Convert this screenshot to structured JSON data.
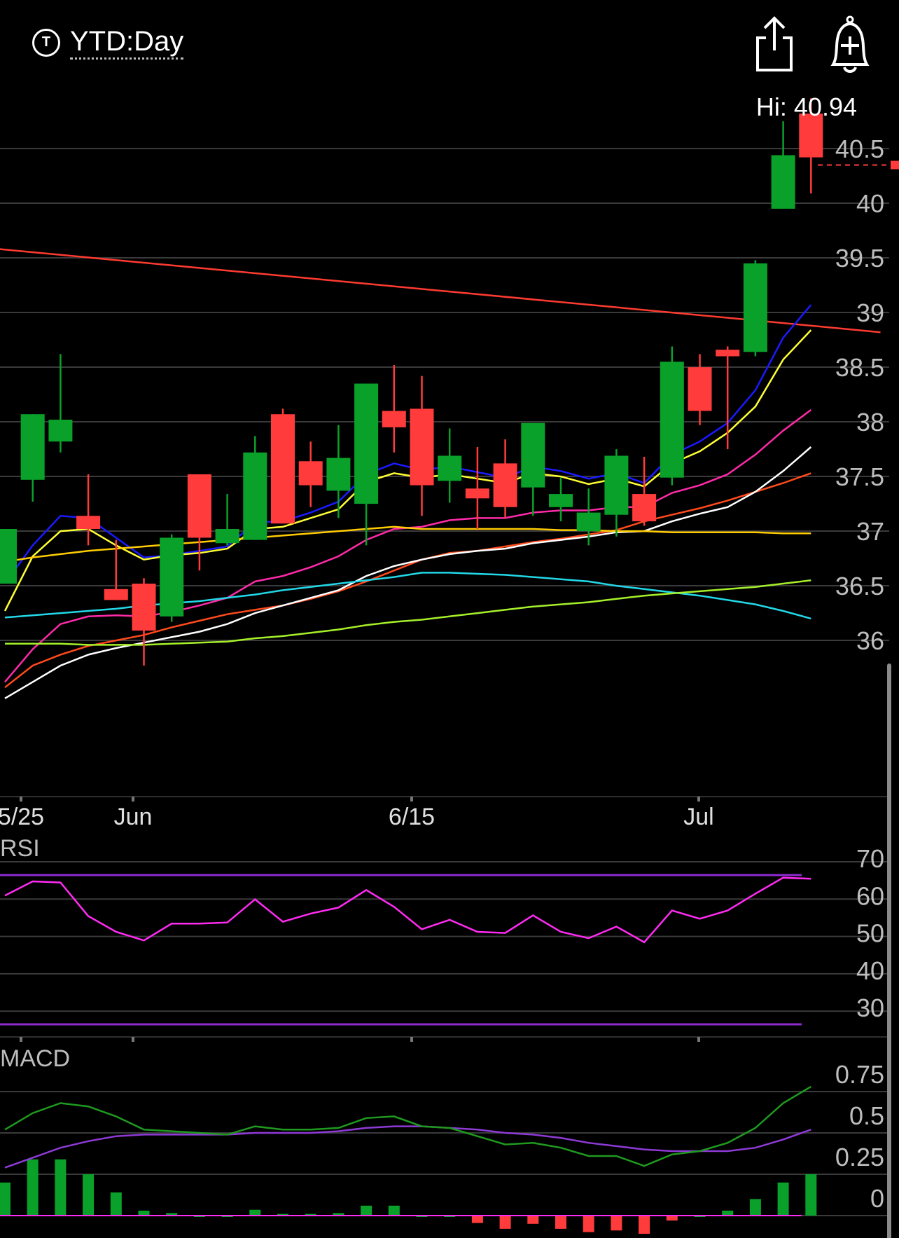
{
  "header": {
    "ticker_badge": "T",
    "period_label": "YTD:Day",
    "share_icon": "share-icon",
    "alert_icon": "add-alert-bell-icon",
    "hi_label": "Hi: 40.94"
  },
  "colors": {
    "background": "#000000",
    "up_candle": "#0aa12a",
    "down_candle": "#ff3b3b",
    "grid": "#3a3a3a",
    "trendline": "#ff3b30",
    "rsi_line": "#ff2bf2",
    "rsi_bands": "#8e2bd0",
    "macd_line": "#1f9a1f",
    "macd_signal": "#8e3ad6"
  },
  "chart_data": [
    {
      "type": "candlestick",
      "title": "",
      "ylim": [
        35.0,
        41.3
      ],
      "y_ticks": [
        "40.5",
        "40",
        "39.5",
        "39",
        "38.5",
        "38",
        "37.5",
        "37",
        "36.5",
        "36"
      ],
      "x_ticks": [
        "5/25",
        "Jun",
        "6/15",
        "Jul"
      ],
      "last_price_marker": 40.33,
      "candles": [
        {
          "o": 36.5,
          "h": 37.0,
          "l": 36.5,
          "c": 37.0
        },
        {
          "o": 37.45,
          "h": 38.05,
          "l": 37.25,
          "c": 38.05
        },
        {
          "o": 37.8,
          "h": 38.6,
          "l": 37.7,
          "c": 38.0
        },
        {
          "o": 37.12,
          "h": 37.5,
          "l": 36.85,
          "c": 37.0
        },
        {
          "o": 36.45,
          "h": 36.9,
          "l": 36.35,
          "c": 36.35
        },
        {
          "o": 36.5,
          "h": 36.55,
          "l": 35.75,
          "c": 36.07
        },
        {
          "o": 36.2,
          "h": 36.95,
          "l": 36.15,
          "c": 36.92
        },
        {
          "o": 37.5,
          "h": 37.5,
          "l": 36.62,
          "c": 36.92
        },
        {
          "o": 36.87,
          "h": 37.32,
          "l": 36.85,
          "c": 37.0
        },
        {
          "o": 36.9,
          "h": 37.85,
          "l": 36.9,
          "c": 37.7
        },
        {
          "o": 38.05,
          "h": 38.1,
          "l": 37.05,
          "c": 37.05
        },
        {
          "o": 37.62,
          "h": 37.8,
          "l": 37.2,
          "c": 37.4
        },
        {
          "o": 37.35,
          "h": 37.95,
          "l": 37.1,
          "c": 37.65
        },
        {
          "o": 37.23,
          "h": 38.33,
          "l": 36.85,
          "c": 38.33
        },
        {
          "o": 38.08,
          "h": 38.5,
          "l": 37.7,
          "c": 37.93
        },
        {
          "o": 38.1,
          "h": 38.4,
          "l": 37.12,
          "c": 37.4
        },
        {
          "o": 37.44,
          "h": 37.92,
          "l": 37.24,
          "c": 37.67
        },
        {
          "o": 37.37,
          "h": 37.75,
          "l": 37.0,
          "c": 37.28
        },
        {
          "o": 37.6,
          "h": 37.82,
          "l": 37.1,
          "c": 37.2
        },
        {
          "o": 37.38,
          "h": 37.97,
          "l": 37.12,
          "c": 37.97
        },
        {
          "o": 37.2,
          "h": 37.47,
          "l": 37.07,
          "c": 37.32
        },
        {
          "o": 36.98,
          "h": 37.37,
          "l": 36.85,
          "c": 37.15
        },
        {
          "o": 37.13,
          "h": 37.73,
          "l": 36.93,
          "c": 37.67
        },
        {
          "o": 37.32,
          "h": 37.66,
          "l": 37.03,
          "c": 37.07
        },
        {
          "o": 37.47,
          "h": 38.67,
          "l": 37.4,
          "c": 38.53
        },
        {
          "o": 38.48,
          "h": 38.6,
          "l": 37.95,
          "c": 38.08
        },
        {
          "o": 38.64,
          "h": 38.67,
          "l": 37.73,
          "c": 38.58
        },
        {
          "o": 38.62,
          "h": 39.46,
          "l": 38.58,
          "c": 39.43
        },
        {
          "o": 39.93,
          "h": 40.73,
          "l": 39.93,
          "c": 40.42
        },
        {
          "o": 40.8,
          "h": 40.94,
          "l": 40.07,
          "c": 40.4
        }
      ],
      "moving_averages": [
        {
          "color": "#1a1aff",
          "values": [
            36.5,
            36.85,
            37.12,
            37.1,
            36.92,
            36.74,
            36.76,
            36.8,
            36.84,
            37.06,
            37.07,
            37.15,
            37.25,
            37.5,
            37.6,
            37.54,
            37.57,
            37.52,
            37.47,
            37.57,
            37.53,
            37.46,
            37.51,
            37.42,
            37.68,
            37.8,
            37.97,
            38.27,
            38.75,
            39.05
          ]
        },
        {
          "color": "#ffff33",
          "values": [
            36.25,
            36.75,
            36.98,
            37.0,
            36.85,
            36.72,
            36.76,
            36.78,
            36.82,
            37.0,
            37.02,
            37.1,
            37.18,
            37.43,
            37.51,
            37.47,
            37.5,
            37.46,
            37.42,
            37.51,
            37.48,
            37.41,
            37.46,
            37.39,
            37.6,
            37.71,
            37.88,
            38.12,
            38.55,
            38.82
          ]
        },
        {
          "color": "#ff2aa8",
          "values": [
            35.6,
            35.9,
            36.13,
            36.2,
            36.21,
            36.2,
            36.24,
            36.3,
            36.37,
            36.52,
            36.57,
            36.65,
            36.75,
            36.9,
            37.0,
            37.02,
            37.08,
            37.1,
            37.1,
            37.15,
            37.17,
            37.17,
            37.2,
            37.2,
            37.33,
            37.4,
            37.5,
            37.68,
            37.9,
            38.09
          ]
        },
        {
          "color": "#ff4a1c",
          "values": [
            35.55,
            35.75,
            35.85,
            35.93,
            35.98,
            36.03,
            36.1,
            36.16,
            36.22,
            36.26,
            36.3,
            36.36,
            36.43,
            36.52,
            36.62,
            36.72,
            36.78,
            36.8,
            36.84,
            36.88,
            36.91,
            36.95,
            36.99,
            37.07,
            37.13,
            37.19,
            37.26,
            37.34,
            37.42,
            37.51
          ]
        },
        {
          "color": "#ffffff",
          "values": [
            35.45,
            35.6,
            35.75,
            35.85,
            35.91,
            35.96,
            36.01,
            36.06,
            36.13,
            36.23,
            36.3,
            36.37,
            36.44,
            36.57,
            36.66,
            36.72,
            36.77,
            36.8,
            36.82,
            36.87,
            36.9,
            36.93,
            36.97,
            36.98,
            37.07,
            37.14,
            37.2,
            37.34,
            37.53,
            37.75
          ]
        },
        {
          "color": "#ffcc00",
          "values": [
            36.7,
            36.74,
            36.77,
            36.8,
            36.82,
            36.84,
            36.86,
            36.88,
            36.9,
            36.92,
            36.94,
            36.96,
            36.98,
            37.0,
            37.02,
            37.0,
            37.0,
            37.0,
            37.0,
            37.0,
            36.99,
            36.99,
            36.98,
            36.98,
            36.97,
            36.97,
            36.97,
            36.97,
            36.96,
            36.96
          ]
        },
        {
          "color": "#22d8e8",
          "values": [
            36.19,
            36.21,
            36.23,
            36.25,
            36.27,
            36.3,
            36.32,
            36.34,
            36.37,
            36.4,
            36.44,
            36.47,
            36.5,
            36.53,
            36.56,
            36.6,
            36.6,
            36.59,
            36.58,
            36.56,
            36.54,
            36.52,
            36.48,
            36.45,
            36.42,
            36.39,
            36.35,
            36.31,
            36.25,
            36.18
          ]
        },
        {
          "color": "#a6f02a",
          "values": [
            35.95,
            35.95,
            35.95,
            35.94,
            35.94,
            35.94,
            35.95,
            35.96,
            35.97,
            36.0,
            36.02,
            36.05,
            36.08,
            36.12,
            36.15,
            36.17,
            36.2,
            36.23,
            36.26,
            36.29,
            36.31,
            36.33,
            36.36,
            36.39,
            36.41,
            36.43,
            36.45,
            36.47,
            36.5,
            36.53
          ]
        }
      ],
      "trendline": {
        "from": {
          "index": -1,
          "value": 39.58
        },
        "to": {
          "index": 31.5,
          "value": 38.8
        }
      }
    },
    {
      "type": "line",
      "title": "RSI",
      "ylim": [
        25,
        75
      ],
      "y_ticks": [
        "70",
        "60",
        "50",
        "40",
        "30"
      ],
      "bands": [
        70,
        25
      ],
      "values": [
        60.0,
        63.8,
        63.5,
        54.5,
        50.3,
        48.0,
        52.5,
        52.5,
        52.8,
        59.0,
        53.0,
        55.2,
        56.8,
        61.5,
        57.0,
        51.0,
        53.5,
        50.3,
        50.0,
        54.7,
        50.3,
        48.6,
        51.7,
        47.5,
        56.0,
        53.8,
        56.0,
        60.5,
        64.8,
        64.5
      ]
    },
    {
      "type": "bar+line",
      "title": "MACD",
      "ylim": [
        -0.1,
        0.8
      ],
      "y_ticks": [
        "0.75",
        "0.5",
        "0.25",
        "0"
      ],
      "macd": [
        0.52,
        0.62,
        0.68,
        0.66,
        0.6,
        0.52,
        0.51,
        0.5,
        0.49,
        0.54,
        0.52,
        0.52,
        0.53,
        0.59,
        0.6,
        0.54,
        0.53,
        0.48,
        0.43,
        0.44,
        0.41,
        0.36,
        0.36,
        0.3,
        0.37,
        0.39,
        0.44,
        0.53,
        0.68,
        0.78
      ],
      "signal": [
        0.29,
        0.35,
        0.41,
        0.45,
        0.48,
        0.49,
        0.49,
        0.49,
        0.49,
        0.5,
        0.5,
        0.5,
        0.51,
        0.53,
        0.54,
        0.54,
        0.53,
        0.52,
        0.5,
        0.49,
        0.47,
        0.44,
        0.42,
        0.4,
        0.39,
        0.39,
        0.39,
        0.41,
        0.46,
        0.52
      ],
      "histogram": [
        0.2,
        0.34,
        0.34,
        0.25,
        0.14,
        0.03,
        0.015,
        0.0,
        0.0,
        0.035,
        0.01,
        0.01,
        0.015,
        0.06,
        0.06,
        0.0,
        0.0,
        -0.045,
        -0.08,
        -0.05,
        -0.08,
        -0.1,
        -0.09,
        -0.11,
        -0.03,
        0.0,
        0.03,
        0.1,
        0.2,
        0.25
      ]
    }
  ]
}
